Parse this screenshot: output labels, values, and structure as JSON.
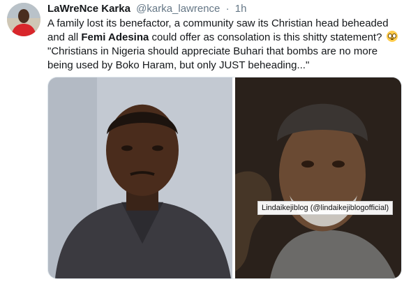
{
  "tweet": {
    "author_name": "LaWreNce Karka",
    "author_handle": "@karka_lawrence",
    "separator": "·",
    "time": "1h",
    "text_part1": "A family lost its benefactor, a community saw its Christian head beheaded and all ",
    "mention": "Femi Adesina",
    "text_part2": " could offer as consolation is this shitty statement? ",
    "emoji": "flushed-face-icon",
    "quote": "\"Christians in Nigeria should appreciate Buhari that bombs are no more being used by Boko Haram,  but only JUST beheading...\""
  },
  "media": {
    "watermark": "Lindaikejiblog (@lindaikejiblogofficial)"
  },
  "colors": {
    "text": "#14171a",
    "secondary": "#657786",
    "avatar_shirt": "#d8262b"
  }
}
